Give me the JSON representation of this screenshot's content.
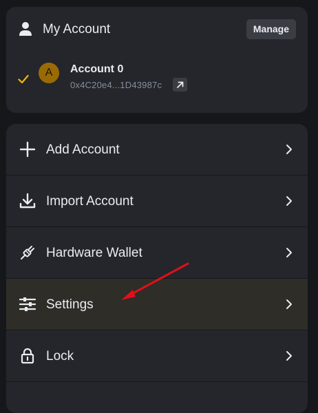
{
  "account_panel": {
    "title": "My Account",
    "manage_label": "Manage",
    "account": {
      "avatar_letter": "A",
      "name": "Account 0",
      "address": "0x4C20e4...1D43987c",
      "selected": true
    }
  },
  "menu": {
    "items": [
      {
        "label": "Add Account",
        "icon": "plus-icon"
      },
      {
        "label": "Import Account",
        "icon": "download-icon"
      },
      {
        "label": "Hardware Wallet",
        "icon": "plug-icon"
      },
      {
        "label": "Settings",
        "icon": "sliders-icon",
        "highlighted": true
      },
      {
        "label": "Lock",
        "icon": "lock-icon"
      }
    ]
  },
  "colors": {
    "background": "#15171b",
    "panel": "#25262b",
    "highlight": "#2e2d28",
    "accent": "#f0b90b",
    "avatar": "#9a6b05",
    "annotation_arrow": "#e0101a"
  }
}
